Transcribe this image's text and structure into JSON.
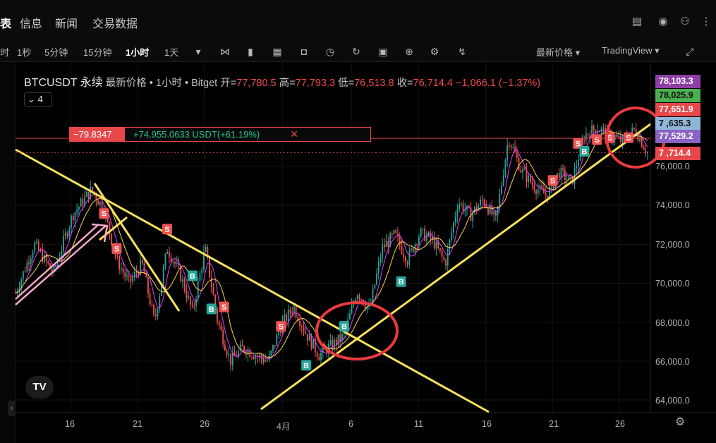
{
  "nav": {
    "partial_tab": "表",
    "tabs": [
      "信息",
      "新闻",
      "交易数据"
    ],
    "icons": [
      "calculator-icon",
      "alarm-icon",
      "user-group-icon",
      "more-icon"
    ]
  },
  "toolbar": {
    "partial": "时",
    "timeframes": [
      "1秒",
      "5分钟",
      "15分钟",
      "1小时",
      "1天"
    ],
    "active_timeframe": "1小时",
    "tools": [
      "indicator-icon",
      "candle-type-icon",
      "template-icon",
      "camera-icon",
      "alarm-clock-icon",
      "replay-icon",
      "calendar-icon",
      "add-icon",
      "gear-icon",
      "chart-tool-icon"
    ],
    "price_type": "最新价格 ▾",
    "provider": "TradingView ▾"
  },
  "legend": {
    "symbol": "BTCUSDT 永续",
    "meta": "最新价格 • 1小时 • Bitget",
    "open_label": "开=",
    "open": "77,780.5",
    "high_label": "高=",
    "high": "77,793.3",
    "low_label": "低=",
    "low": "76,513.8",
    "close_label": "收=",
    "close": "76,714.4",
    "change": "−1,066.1 (−1.37%)"
  },
  "ma_box": "4",
  "position": {
    "pnl": "−79.8347",
    "value": "+74,955.0633 USDT(+61.19%)",
    "close_symbol": "✕"
  },
  "price_labels": [
    {
      "text": "78,103.3",
      "color": "#8e3fa6"
    },
    {
      "text": "78,025.9",
      "color": "#4caf50"
    },
    {
      "text": "77,651.9",
      "color": "#e8474a"
    },
    {
      "text": "7 ,635.3",
      "color": "#8fb5d9"
    },
    {
      "text": "77,529.2",
      "color": "#8a63c4"
    },
    {
      "text": "7 ,714.4",
      "color": "#e8474a"
    }
  ],
  "chart_data": {
    "type": "candlestick",
    "x": [
      "16",
      "21",
      "26",
      "4月",
      "6",
      "11",
      "16",
      "21",
      "26"
    ],
    "y_ticks": [
      "76,000.0",
      "74,000.0",
      "72,000.0",
      "70,000.0",
      "68,000.0",
      "66,000.0",
      "64,000.0"
    ],
    "ylim": [
      63500,
      79000
    ],
    "series": [
      {
        "values_approx": [
          [
            0,
            69500
          ],
          [
            3,
            72000
          ],
          [
            6,
            70500
          ],
          [
            9,
            73500
          ],
          [
            12,
            74800
          ],
          [
            14,
            73800
          ],
          [
            16,
            71200
          ],
          [
            18,
            70000
          ],
          [
            20,
            71000
          ],
          [
            22,
            68000
          ],
          [
            24,
            71800
          ],
          [
            26,
            70500
          ],
          [
            28,
            68500
          ],
          [
            30,
            71800
          ],
          [
            32,
            68000
          ],
          [
            34,
            66000
          ],
          [
            36,
            66700
          ],
          [
            38,
            66300
          ],
          [
            40,
            66000
          ],
          [
            42,
            67800
          ],
          [
            44,
            68800
          ],
          [
            46,
            67400
          ],
          [
            48,
            66300
          ],
          [
            50,
            66800
          ],
          [
            52,
            67300
          ],
          [
            54,
            69600
          ],
          [
            56,
            68600
          ],
          [
            58,
            71800
          ],
          [
            60,
            72500
          ],
          [
            62,
            71200
          ],
          [
            64,
            72600
          ],
          [
            66,
            72200
          ],
          [
            68,
            71000
          ],
          [
            70,
            74200
          ],
          [
            72,
            73500
          ],
          [
            74,
            74300
          ],
          [
            76,
            73200
          ],
          [
            78,
            77500
          ],
          [
            80,
            75800
          ],
          [
            82,
            75000
          ],
          [
            84,
            74500
          ],
          [
            86,
            75700
          ],
          [
            88,
            75200
          ],
          [
            90,
            77600
          ],
          [
            92,
            78000
          ],
          [
            94,
            77600
          ],
          [
            96,
            77300
          ],
          [
            98,
            77900
          ],
          [
            100,
            76700
          ]
        ]
      }
    ],
    "signals": [
      {
        "type": "S",
        "t": 14,
        "price": 73600
      },
      {
        "type": "S",
        "t": 16,
        "price": 71800
      },
      {
        "type": "S",
        "t": 24,
        "price": 72800
      },
      {
        "type": "B",
        "t": 28,
        "price": 70400
      },
      {
        "type": "B",
        "t": 31,
        "price": 68700
      },
      {
        "type": "S",
        "t": 33,
        "price": 68800
      },
      {
        "type": "S",
        "t": 42,
        "price": 67800
      },
      {
        "type": "B",
        "t": 46,
        "price": 65800
      },
      {
        "type": "B",
        "t": 52,
        "price": 67800
      },
      {
        "type": "B",
        "t": 61,
        "price": 70100
      },
      {
        "type": "S",
        "t": 85,
        "price": 75300
      },
      {
        "type": "S",
        "t": 89,
        "price": 77200
      },
      {
        "type": "B",
        "t": 90,
        "price": 76800
      },
      {
        "type": "S",
        "t": 92,
        "price": 77400
      },
      {
        "type": "S",
        "t": 94,
        "price": 77500
      },
      {
        "type": "S",
        "t": 97,
        "price": 77500
      }
    ],
    "current_price": "76,714.4",
    "position_entry": 77450
  }
}
